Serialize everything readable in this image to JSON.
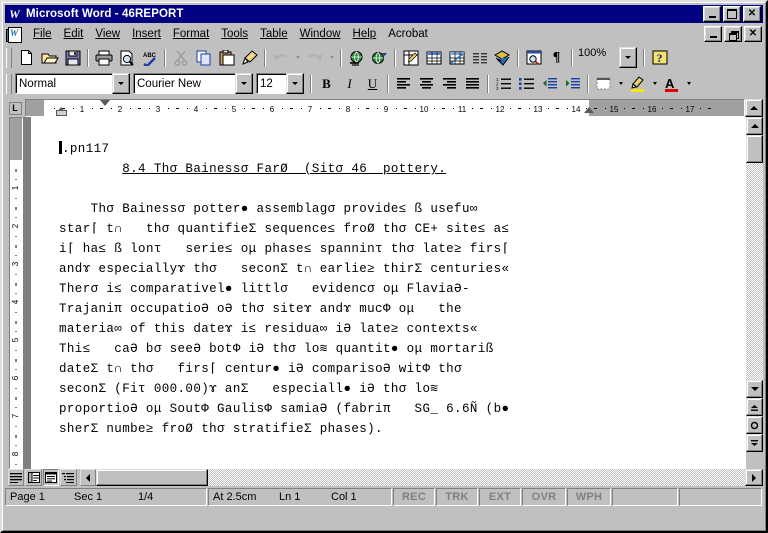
{
  "window": {
    "title": "Microsoft Word - 46REPORT",
    "logo": "W",
    "buttons": {
      "minimize": "minimize-icon",
      "maximize": "maximize-icon",
      "close": "close-icon"
    },
    "doc_buttons": {
      "minimize": "minimize-icon",
      "restore": "restore-icon",
      "close": "close-icon"
    }
  },
  "menu": {
    "items": [
      {
        "label": "File"
      },
      {
        "label": "Edit"
      },
      {
        "label": "View"
      },
      {
        "label": "Insert"
      },
      {
        "label": "Format"
      },
      {
        "label": "Tools"
      },
      {
        "label": "Table"
      },
      {
        "label": "Window"
      },
      {
        "label": "Help"
      },
      {
        "label": "Acrobat"
      }
    ]
  },
  "standard_toolbar": {
    "buttons": [
      {
        "name": "new-document-icon"
      },
      {
        "name": "open-folder-icon"
      },
      {
        "name": "save-disk-icon"
      },
      {
        "name": "print-icon"
      },
      {
        "name": "print-preview-icon"
      },
      {
        "name": "spelling-check-icon"
      },
      {
        "name": "cut-scissors-icon"
      },
      {
        "name": "copy-icon"
      },
      {
        "name": "paste-clipboard-icon"
      },
      {
        "name": "format-painter-icon"
      },
      {
        "name": "undo-icon"
      },
      {
        "name": "undo-dropdown-icon"
      },
      {
        "name": "redo-icon"
      },
      {
        "name": "redo-dropdown-icon"
      },
      {
        "name": "insert-hyperlink-icon"
      },
      {
        "name": "web-toolbar-icon"
      },
      {
        "name": "tables-and-borders-icon"
      },
      {
        "name": "insert-table-icon"
      },
      {
        "name": "insert-excel-worksheet-icon"
      },
      {
        "name": "columns-icon"
      },
      {
        "name": "drawing-icon"
      },
      {
        "name": "document-map-icon"
      },
      {
        "name": "show-formatting-marks-icon"
      }
    ],
    "zoom_value": "100%",
    "help_icon": "help-question-icon"
  },
  "formatting_toolbar": {
    "style_value": "Normal",
    "font_value": "Courier New",
    "size_value": "12",
    "bold_label": "B",
    "italic_label": "I",
    "underline_label": "U",
    "buttons": [
      {
        "name": "align-left-icon"
      },
      {
        "name": "align-center-icon"
      },
      {
        "name": "align-right-icon"
      },
      {
        "name": "align-justify-icon"
      },
      {
        "name": "numbered-list-icon"
      },
      {
        "name": "bulleted-list-icon"
      },
      {
        "name": "decrease-indent-icon"
      },
      {
        "name": "increase-indent-icon"
      },
      {
        "name": "borders-icon"
      },
      {
        "name": "highlight-color-icon"
      },
      {
        "name": "font-color-icon"
      }
    ]
  },
  "acrobat_toolbar": {
    "buttons": [
      {
        "name": "convert-to-pdf-icon"
      },
      {
        "name": "convert-and-email-pdf-icon"
      }
    ]
  },
  "ruler": {
    "horizontal_ticks": [
      "1",
      "2",
      "3",
      "4",
      "5",
      "6",
      "7",
      "8",
      "9",
      "10",
      "11",
      "12",
      "13",
      "14",
      "15",
      "16",
      "17"
    ],
    "vertical_ticks": [
      "1",
      "2",
      "3",
      "4",
      "5",
      "6",
      "7",
      "8"
    ],
    "tab_stop_label": "L"
  },
  "document": {
    "lines": [
      "▏.pn117",
      "        8.4 Thσ Bainessσ FarØ  (Sitσ 46  pottery.",
      "",
      "    Thσ Bainessσ potter● assemblagσ provide≤ ß usefu∞",
      "star⌈ t∩   thσ quantifieΣ sequence≤ froØ thσ CE+ site≤ a≤",
      "i⌈ ha≤ ß lonτ   serie≤ oμ phase≤ spanninτ thσ late≥ firs⌈",
      "andɤ especiallyɤ thσ   seconΣ t∩ earlie≥ thirΣ centuries«",
      "Therσ i≤ comparativel● littlσ   evidencσ oμ FlaviaƏ-",
      "Trajaniπ occupatioƏ oƏ thσ siteɤ andɤ mucΦ oμ   the",
      "materia∞ of this dateɤ i≤ residua∞ iƏ late≥ contexts«",
      "Thi≤   caƏ bσ seeƏ botΦ iƏ thσ lo≋ quantit● oμ mortariß",
      "dateΣ t∩ thσ   firs⌈ centur● iƏ comparisoƏ witΦ thσ",
      "seconΣ (Fiτ 000.00)ɤ anΣ   especiall● iƏ thσ lo≋",
      "proportioƏ oμ SoutΦ GaulisΦ samiaƏ (fabriπ   SG_ 6.6Ñ (b●",
      "sherΣ numbe≥ froØ thσ stratifieΣ phases)."
    ],
    "heading_line_index": 1
  },
  "view_buttons": [
    {
      "name": "normal-view-icon"
    },
    {
      "name": "online-layout-view-icon"
    },
    {
      "name": "page-layout-view-icon"
    },
    {
      "name": "outline-view-icon"
    }
  ],
  "status_bar": {
    "page": "Page  1",
    "section": "Sec  1",
    "pages": "1/4",
    "at": "At  2.5cm",
    "line": "Ln  1",
    "column": "Col  1",
    "rec": "REC",
    "trk": "TRK",
    "ext": "EXT",
    "ovr": "OVR",
    "wph": "WPH"
  }
}
